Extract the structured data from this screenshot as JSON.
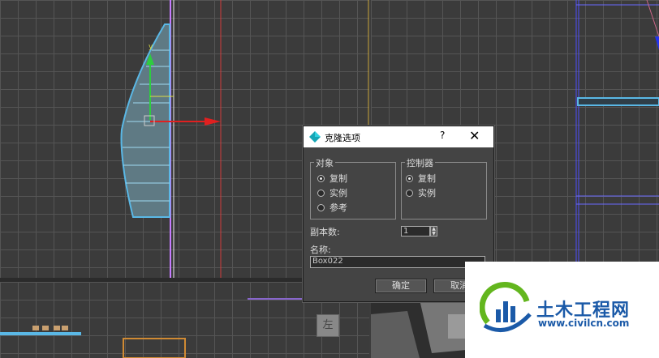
{
  "dialog": {
    "title": "克隆选项",
    "help": "?",
    "close": "✕",
    "object_group": {
      "label": "对象",
      "options": [
        "复制",
        "实例",
        "参考"
      ],
      "selected": 0
    },
    "controller_group": {
      "label": "控制器",
      "options": [
        "复制",
        "实例"
      ],
      "selected": 0
    },
    "copies_label": "副本数:",
    "copies_value": "1",
    "name_label": "名称:",
    "name_value": "Box022",
    "ok_label": "确定",
    "cancel_label": "取消"
  },
  "viewport": {
    "view_cube_label": "左",
    "gizmo_y": "y"
  },
  "watermark": {
    "brand": "土木工程网",
    "url": "www.civilcn.com"
  },
  "colors": {
    "selection": "#5ab8e6",
    "grid": "#555555",
    "dialog_bg": "#444444",
    "logo_blue": "#1b5aa8",
    "logo_green": "#63b61e"
  }
}
